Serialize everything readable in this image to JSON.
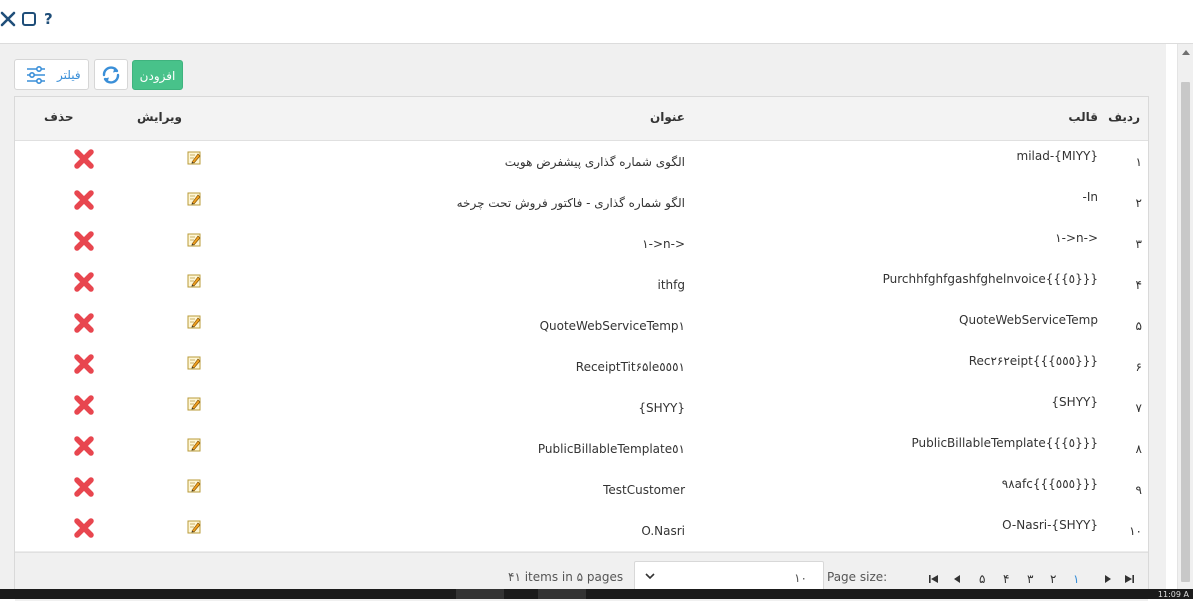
{
  "window": {
    "close_glyph": "✕",
    "maximize_glyph": "▢",
    "help_glyph": "?"
  },
  "toolbar": {
    "filter_label": "فیلتر",
    "add_label": "افزودن",
    "filter_icon": "sliders-icon",
    "refresh_icon": "refresh-icon"
  },
  "grid": {
    "headers": {
      "row": "ردیف",
      "template": "قالب",
      "title": "عنوان",
      "edit": "ویرایش",
      "delete": "حذف"
    },
    "rows": [
      {
        "idx": "١",
        "template": "milad-{MIYY}",
        "title": "الگوی شماره گذاری پیشفرض هویت"
      },
      {
        "idx": "٢",
        "template": "-In",
        "title": "الگو شماره گذاری - فاکتور فروش تحت چرخه"
      },
      {
        "idx": "٣",
        "template": "١->n->",
        "title": "١->n->"
      },
      {
        "idx": "۴",
        "template": "Purchhfghfgashfghelnvoice{{{٥}}}",
        "title": "ithfg"
      },
      {
        "idx": "۵",
        "template": "QuoteWebServiceTemp",
        "title": "QuoteWebServiceTemp١"
      },
      {
        "idx": "۶",
        "template": "Rec۲۶۲eipt{{{٥٥٥}}}",
        "title": "ReceiptTit۶۵le٥٥٥١"
      },
      {
        "idx": "٧",
        "template": "{SHYY}",
        "title": "{SHYY}"
      },
      {
        "idx": "٨",
        "template": "PublicBillableTemplate{{{٥}}}",
        "title": "PublicBillableTemplate٥١"
      },
      {
        "idx": "٩",
        "template": "٩٨afc{{{٥٥٥}}}",
        "title": "TestCustomer"
      },
      {
        "idx": "١٠",
        "template": "O-Nasri-{SHYY}",
        "title": "O.Nasri"
      }
    ]
  },
  "pagination": {
    "info": "۴١ items in ۵ pages",
    "page_size_label": "Page size:",
    "page_size_value": "١٠",
    "pages": [
      "۵",
      "۴",
      "٣",
      "٢",
      "١"
    ],
    "active_page": "١"
  },
  "taskbar": {
    "clock": "11:09 A"
  },
  "colors": {
    "accent": "#3a8fd8",
    "add_green": "#48c28a",
    "delete_red": "#e8464f"
  }
}
